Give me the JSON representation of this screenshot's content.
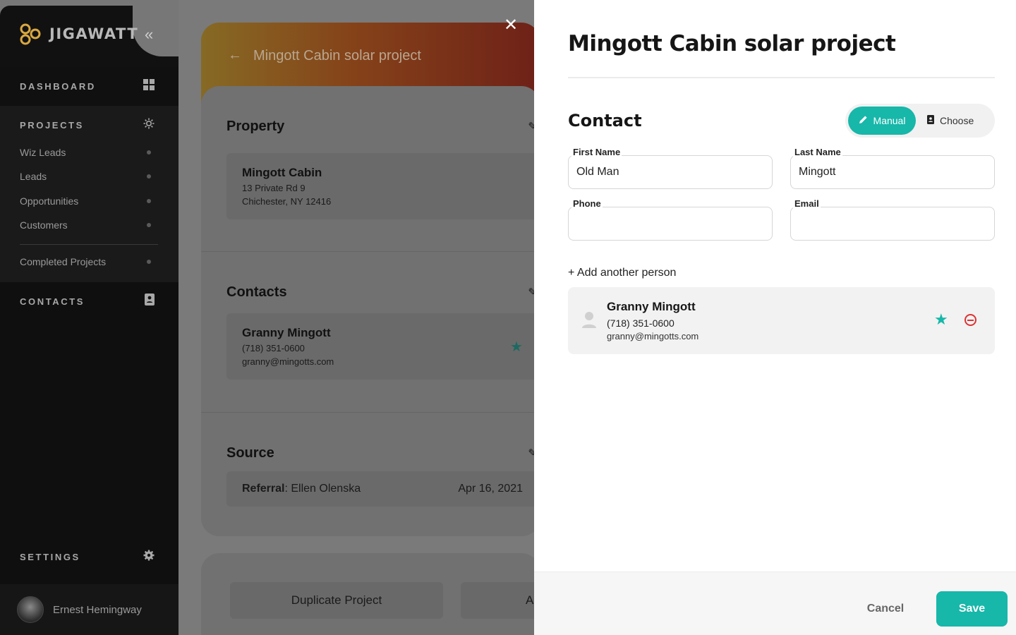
{
  "app": {
    "name": "JIGAWATT"
  },
  "sidebar": {
    "dashboard": "DASHBOARD",
    "projects": "PROJECTS",
    "project_items": [
      "Wiz Leads",
      "Leads",
      "Opportunities",
      "Customers"
    ],
    "completed": "Completed Projects",
    "contacts": "CONTACTS",
    "settings": "SETTINGS",
    "user": "Ernest Hemingway"
  },
  "main": {
    "title": "Mingott Cabin solar project",
    "property": {
      "heading": "Property",
      "name": "Mingott Cabin",
      "line1": "13 Private Rd 9",
      "line2": "Chichester, NY 12416"
    },
    "contacts": {
      "heading": "Contacts",
      "name": "Granny Mingott",
      "phone": "(718) 351-0600",
      "email": "granny@mingotts.com"
    },
    "source": {
      "heading": "Source",
      "key": "Referral",
      "value": ": Ellen Olenska",
      "date": "Apr 16, 2021"
    },
    "buttons": {
      "duplicate": "Duplicate Project",
      "second": "A"
    }
  },
  "drawer": {
    "title": "Mingott Cabin solar project",
    "section": "Contact",
    "toggle": {
      "manual": "Manual",
      "choose": "Choose"
    },
    "fields": {
      "first_name_label": "First Name",
      "first_name_value": "Old Man",
      "last_name_label": "Last Name",
      "last_name_value": "Mingott",
      "phone_label": "Phone",
      "phone_value": "",
      "email_label": "Email",
      "email_value": ""
    },
    "add_person": "+ Add another person",
    "person": {
      "name": "Granny Mingott",
      "phone": "(718) 351-0600",
      "email": "granny@mingotts.com"
    },
    "footer": {
      "cancel": "Cancel",
      "save": "Save"
    }
  },
  "colors": {
    "accent": "#17b7a9",
    "danger": "#d33333",
    "sidebar_bg": "#0f0f0f"
  }
}
